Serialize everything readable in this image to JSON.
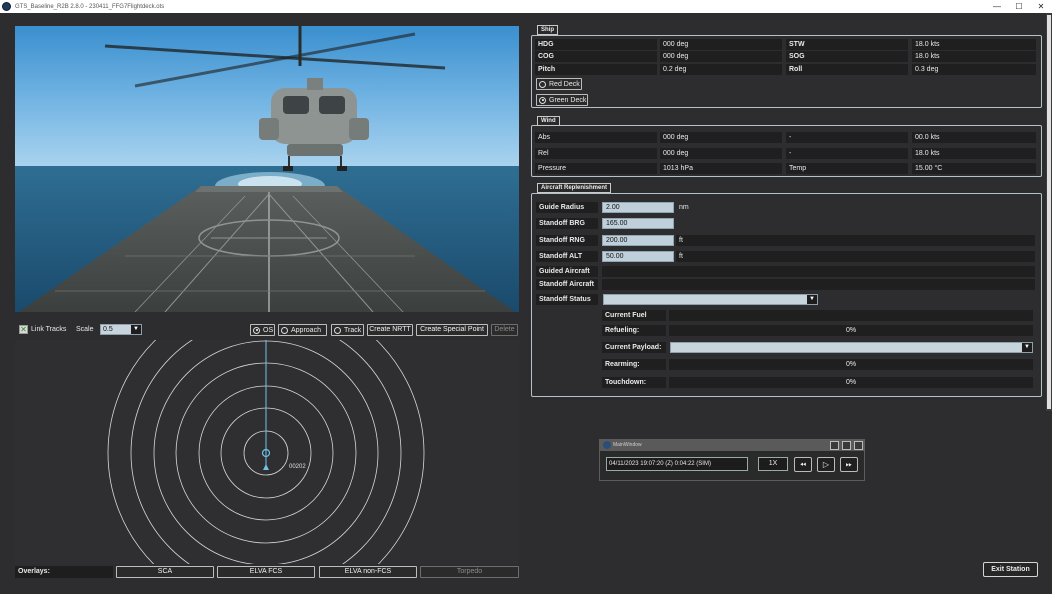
{
  "window": {
    "title": "GTS_Baseline_R2B 2.8.0 - 230411_FFG7Flightdeck.ots",
    "minimize": "—",
    "maximize": "☐",
    "close": "✕"
  },
  "controls": {
    "link_tracks": "Link Tracks",
    "link_tracks_checked": true,
    "scale_label": "Scale",
    "scale_value": "0.5",
    "os_label": "OS",
    "approach_label": "Approach",
    "track_label": "Track",
    "create_nrtt": "Create NRTT",
    "create_special_point": "Create Special Point",
    "delete": "Delete"
  },
  "radar": {
    "contact_label": "00202"
  },
  "overlays": {
    "label": "Overlays:",
    "buttons": [
      "SCA",
      "ELVA FCS",
      "ELVA non-FCS",
      "Torpedo"
    ]
  },
  "ship": {
    "title": "Ship",
    "rows": [
      {
        "l1": "HDG",
        "v1": "000 deg",
        "l2": "STW",
        "v2": "18.0 kts"
      },
      {
        "l1": "COG",
        "v1": "000 deg",
        "l2": "SOG",
        "v2": "18.0 kts"
      },
      {
        "l1": "Pitch",
        "v1": "0.2 deg",
        "l2": "Roll",
        "v2": "0.3 deg"
      }
    ],
    "red_deck": "Red Deck",
    "green_deck": "Green Deck"
  },
  "wind": {
    "title": "Wind",
    "rows": [
      {
        "l1": "Abs",
        "v1": "000  deg",
        "l2": "-",
        "v2": "00.0  kts"
      },
      {
        "l1": "Rel",
        "v1": "000  deg",
        "l2": "-",
        "v2": "18.0  kts"
      },
      {
        "l1": "Pressure",
        "v1": "1013 hPa",
        "l2": "Temp",
        "v2": "15.00 °C"
      }
    ]
  },
  "replenishment": {
    "title": "Aircraft Replenishment",
    "guide_radius_label": "Guide Radius",
    "guide_radius_value": "2.00",
    "guide_radius_unit": "nm",
    "standoff_brg_label": "Standoff BRG",
    "standoff_brg_value": "165.00",
    "standoff_rng_label": "Standoff RNG",
    "standoff_rng_value": "200.00",
    "standoff_rng_unit": "ft",
    "standoff_alt_label": "Standoff ALT",
    "standoff_alt_value": "50.00",
    "standoff_alt_unit": "ft",
    "guided_aircraft_label": "Guided Aircraft",
    "standoff_aircraft_label": "Standoff Aircraft",
    "standoff_status_label": "Standoff Status",
    "current_fuel_label": "Current Fuel",
    "refueling_label": "Refueling:",
    "refueling_value": "0%",
    "current_payload_label": "Current Payload:",
    "rearming_label": "Rearming:",
    "rearming_value": "0%",
    "touchdown_label": "Touchdown:",
    "touchdown_value": "0%"
  },
  "playback": {
    "title": "MainWindow",
    "timestamp": "04/11/2023 19:07:20 (Z) 0:04:22 (SIM)",
    "speed": "1X"
  },
  "exit_station": "Exit Station",
  "colors": {
    "background": "#2d2d2f",
    "input_fill": "#bfd0da",
    "radar_ring": "#d8d8d8",
    "radar_heading": "#6fc3ea"
  }
}
